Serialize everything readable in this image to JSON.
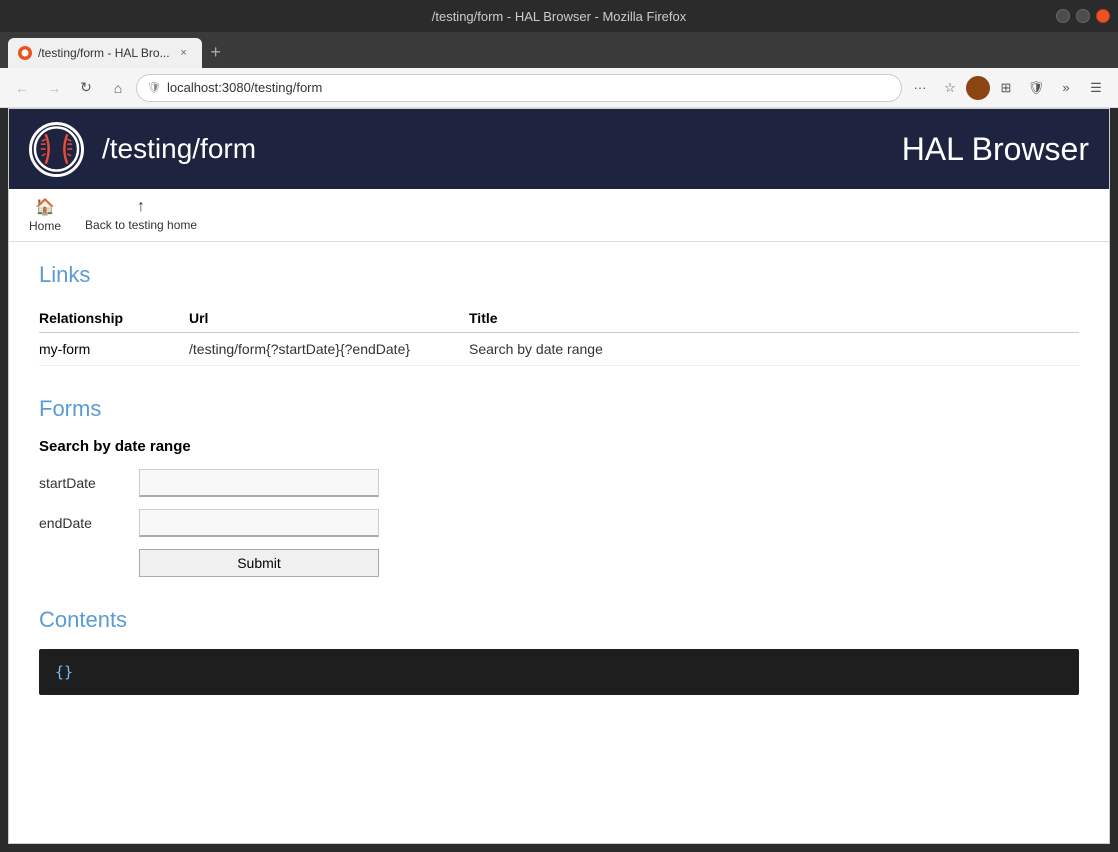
{
  "browser": {
    "title_bar": "/testing/form - HAL Browser - Mozilla Firefox",
    "tab_title": "/testing/form - HAL Bro...",
    "tab_favicon_label": "firefox-favicon",
    "tab_close_label": "×",
    "tab_new_label": "+",
    "nav": {
      "back_tooltip": "Back",
      "forward_tooltip": "Forward",
      "refresh_tooltip": "Refresh",
      "home_tooltip": "Home",
      "url": "localhost:3080/testing/form",
      "more_tooltip": "...",
      "bookmark_tooltip": "☆",
      "extensions_label": "⊞",
      "menu_tooltip": "≡"
    }
  },
  "hal": {
    "path": "/testing/form",
    "brand": "HAL Browser",
    "logo_inner": "⚾"
  },
  "breadcrumb": {
    "home_label": "Home",
    "home_icon": "🏠",
    "back_label": "Back to testing home",
    "back_icon": "↑"
  },
  "links_section": {
    "title": "Links",
    "columns": {
      "relationship": "Relationship",
      "url": "Url",
      "title": "Title"
    },
    "rows": [
      {
        "relationship": "my-form",
        "url": "/testing/form{?startDate}{?endDate}",
        "title": "Search by date range"
      }
    ]
  },
  "forms_section": {
    "title": "Forms",
    "form_title": "Search by date range",
    "fields": [
      {
        "name": "startDate",
        "label": "startDate",
        "placeholder": ""
      },
      {
        "name": "endDate",
        "label": "endDate",
        "placeholder": ""
      }
    ],
    "submit_label": "Submit"
  },
  "contents_section": {
    "title": "Contents",
    "code": "{}"
  },
  "window_controls": {
    "minimize": "—",
    "maximize": "□",
    "close": "✕"
  }
}
